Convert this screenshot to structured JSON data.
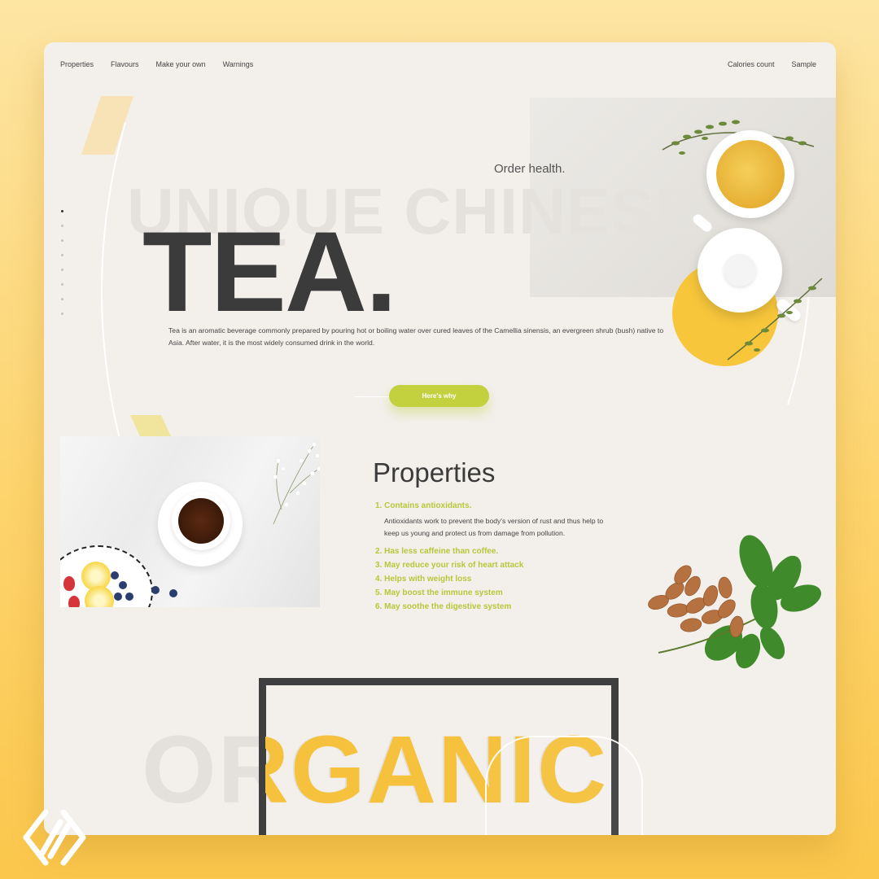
{
  "nav": {
    "left": [
      "Properties",
      "Flavours",
      "Make your own",
      "Warnings"
    ],
    "right": [
      "Calories count",
      "Sample"
    ]
  },
  "hero": {
    "bg_title": "UNIQUE CHINESE",
    "tagline": "Order health.",
    "title": "TEA.",
    "description": "Tea is an aromatic beverage commonly prepared by pouring hot or boiling water over cured leaves of the Camellia sinensis, an evergreen shrub (bush) native to Asia. After water, it is the most widely consumed drink in the world.",
    "cta": "Here's why"
  },
  "pager": {
    "count": 8,
    "active": 1
  },
  "properties": {
    "title": "Properties",
    "items": [
      {
        "label": "1. Contains antioxidants.",
        "detail": "Antioxidants work to prevent the body's version of rust and thus help to keep us young and protect us from damage from pollution."
      },
      {
        "label": "2. Has less caffeine than coffee."
      },
      {
        "label": "3. May reduce your risk of heart attack"
      },
      {
        "label": "4. Helps with weight loss"
      },
      {
        "label": "5. May boost the immune system"
      },
      {
        "label": "6. May soothe the digestive system"
      }
    ]
  },
  "organic": {
    "word": "ORGANIC"
  },
  "colors": {
    "accent_green": "#c2d13d",
    "accent_yellow": "#f6c13c",
    "dark": "#3b3b3b",
    "card_bg": "#f3f0ec"
  },
  "icons": [
    "brand-logo-icon"
  ]
}
